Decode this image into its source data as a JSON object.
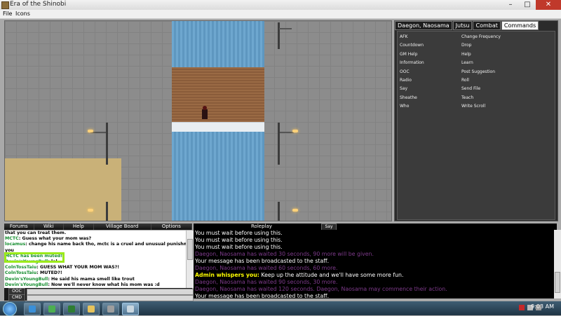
{
  "window": {
    "title": "Era of the Shinobi"
  },
  "menu": {
    "items": [
      "File",
      "Icons"
    ]
  },
  "panel": {
    "tabs": [
      "Daegon, Naosama",
      "Jutsu",
      "Combat",
      "Commands"
    ],
    "active_tab": "Commands",
    "commands_left": [
      "AFK",
      "Countdown",
      "GM Help",
      "Information",
      "OOC",
      "Radio",
      "Say",
      "Sheathe",
      "Who"
    ],
    "commands_right": [
      "Change Frequency",
      "Drop",
      "Help",
      "Learn",
      "Post Suggestion",
      "Roll",
      "Send File",
      "Teach",
      "Write Scroll"
    ]
  },
  "toolbar": {
    "buttons": [
      "Forums",
      "Wiki",
      "Help",
      "Village Board",
      "Options"
    ],
    "roleplay_label": "Roleplay",
    "say_label": "Say"
  },
  "chat_left": {
    "lines": [
      {
        "name": "",
        "text": "that you can treat them."
      },
      {
        "name": "MCTC",
        "text": ": Guess what your mom was?"
      },
      {
        "name": "locamus",
        "text": ": change his name back tho, mctc is a cruel and unusual punishment for"
      },
      {
        "name": "",
        "text": "you"
      },
      {
        "name": "",
        "text": "MCTC has been muted!"
      },
      {
        "name": "Devin'sYoungBull",
        "text": ": lol"
      },
      {
        "name": "ColnTossTaiu",
        "text": ": GUESS WHAT YOUR MOM WAS?!"
      },
      {
        "name": "ColnTossTaiu",
        "text": ": MUTED?!"
      },
      {
        "name": "Devin'sYoungBull",
        "text": ": He said his mama smell like trout"
      },
      {
        "name": "Devin'sYoungBull",
        "text": ": Now we'll never know what his mom was :d"
      }
    ],
    "modes": [
      "OOC",
      "CMD"
    ]
  },
  "chat_right": {
    "lines": [
      {
        "style": "white",
        "text": "You must wait before using this."
      },
      {
        "style": "white",
        "text": "You must wait before using this."
      },
      {
        "style": "white",
        "text": "You must wait before using this."
      },
      {
        "style": "purple",
        "text": "Daegon, Naosama has waited 30 seconds, 90 more will be given."
      },
      {
        "style": "white",
        "text": "Your message has been broadcasted to the staff."
      },
      {
        "style": "purple",
        "text": "Daegon, Naosama has waited 60 seconds, 60 more."
      },
      {
        "style": "admin",
        "speaker": "Admin whispers you:",
        "text": " Keep up the attitude and we'll have some more fun."
      },
      {
        "style": "purple",
        "text": "Daegon, Naosama has waited 90 seconds, 30 more."
      },
      {
        "style": "purple",
        "text": "Daegon, Naosama has waited 120 seconds. Daegon, Naosama may commence their action."
      },
      {
        "style": "white",
        "text": "Your message has been broadcasted to the staff."
      }
    ]
  },
  "taskbar": {
    "clock": "9:03 AM"
  },
  "colors": {
    "name_green": "#148d2e",
    "admin_yellow": "#ffff00",
    "system_purple": "#7d3a8a",
    "highlight_green": "#9bea1a"
  }
}
